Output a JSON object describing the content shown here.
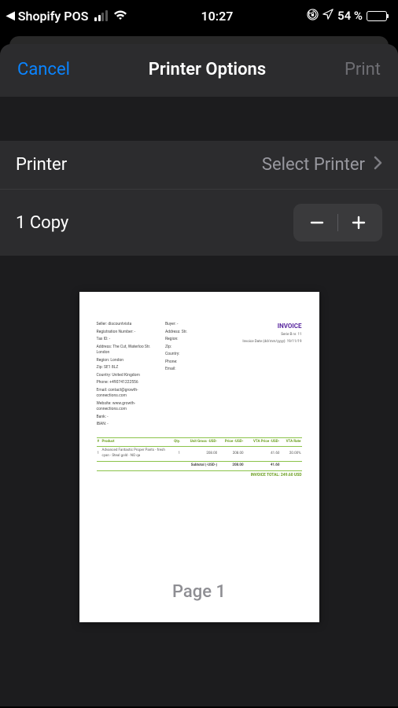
{
  "status": {
    "back_app": "Shopify POS",
    "time": "10:27",
    "battery_pct": "54 %"
  },
  "header": {
    "cancel": "Cancel",
    "title": "Printer Options",
    "print": "Print"
  },
  "rows": {
    "printer_label": "Printer",
    "printer_value": "Select Printer",
    "copies_label": "1 Copy"
  },
  "preview": {
    "page_label": "Page 1",
    "invoice": {
      "title": "INVOICE",
      "seller": {
        "name": "Seller: discountvista",
        "reg": "Registration Number: -",
        "tax": "Tax ID: -",
        "addr": "Address: The Cut, Waterloo Str. London",
        "region": "Region: London",
        "zip": "Zip: SE1 8LZ",
        "country": "Country: United Kingdom",
        "phone": "Phone: +490741222556",
        "email": "Email: contact@growth-connections.com",
        "website": "Website: www.growth-connections.com",
        "bank": "Bank: -",
        "iban": "IBAN: -"
      },
      "buyer": {
        "name": "Buyer: -",
        "addr": "Address: Str.",
        "region": "Region:",
        "zip": "Zip:",
        "country": "Country:",
        "phone": "Phone:",
        "email": "Email:"
      },
      "meta": {
        "serie": "Serie B nr. 11",
        "date": "Invoice Date (dd/mm/yyyy): 19/11/19"
      },
      "table": {
        "headers": {
          "n": "#",
          "product": "Product",
          "qty": "Qty.",
          "unit": "Unit Gross -USD-",
          "price": "Price -USD-",
          "vta_price": "VTA Price -USD-",
          "vta_rate": "VTA Rate"
        },
        "row": {
          "n": "1",
          "product": "Advanced Fantastic Proper Pants - fresh cyan - Steal gold - NO qa",
          "qty": "1",
          "unit": "208.00",
          "price": "208.00",
          "vta_price": "41.60",
          "vta_rate": "20.00%"
        },
        "sub": {
          "label": "Subtotal (-USD-)",
          "price": "208.00",
          "vta": "41.60"
        },
        "total": "INVOICE TOTAL: 249.60 USD"
      }
    }
  }
}
